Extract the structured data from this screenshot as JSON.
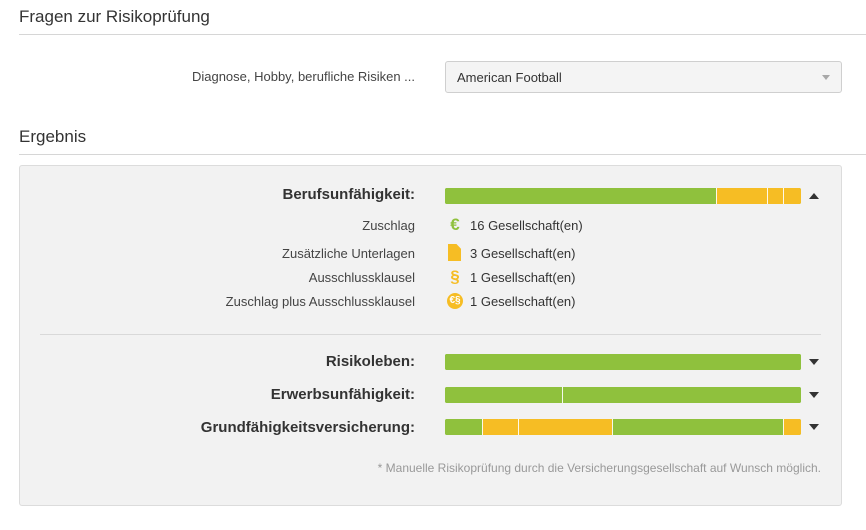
{
  "questions": {
    "title": "Fragen zur Risikoprüfung",
    "field_label": "Diagnose, Hobby, berufliche Risiken ...",
    "field_value": "American Football"
  },
  "result": {
    "title": "Ergebnis",
    "rows": [
      {
        "label": "Berufsunfähigkeit:",
        "expanded": true,
        "segments": [
          {
            "color": "green",
            "fraction": 0.76
          },
          {
            "color": "yellow",
            "fraction": 0.145
          },
          {
            "color": "yellow",
            "fraction": 0.045
          },
          {
            "color": "yellow",
            "fraction": 0.05
          }
        ],
        "details": [
          {
            "label": "Zuschlag",
            "icon": "euro-icon",
            "value": "16 Gesellschaft(en)"
          },
          {
            "label": "Zusätzliche Unterlagen",
            "icon": "document-icon",
            "value": "3 Gesellschaft(en)"
          },
          {
            "label": "Ausschlussklausel",
            "icon": "paragraph-icon",
            "value": "1 Gesellschaft(en)"
          },
          {
            "label": "Zuschlag plus Ausschlussklausel",
            "icon": "euro-paragraph-icon",
            "value": "1 Gesellschaft(en)"
          }
        ]
      },
      {
        "label": "Risikoleben:",
        "expanded": false,
        "segments": [
          {
            "color": "green",
            "fraction": 1.0
          }
        ]
      },
      {
        "label": "Erwerbsunfähigkeit:",
        "expanded": false,
        "segments": [
          {
            "color": "green",
            "fraction": 0.33
          },
          {
            "color": "green",
            "fraction": 0.67
          }
        ]
      },
      {
        "label": "Grundfähigkeitsversicherung:",
        "expanded": false,
        "segments": [
          {
            "color": "green",
            "fraction": 0.105
          },
          {
            "color": "yellow",
            "fraction": 0.1
          },
          {
            "color": "yellow",
            "fraction": 0.265
          },
          {
            "color": "green",
            "fraction": 0.48
          },
          {
            "color": "yellow",
            "fraction": 0.05
          }
        ]
      }
    ],
    "footnote": "* Manuelle Risikoprüfung durch die Versicherungsgesellschaft auf Wunsch möglich."
  },
  "colors": {
    "green": "#8fc13d",
    "yellow": "#f6bd24"
  }
}
